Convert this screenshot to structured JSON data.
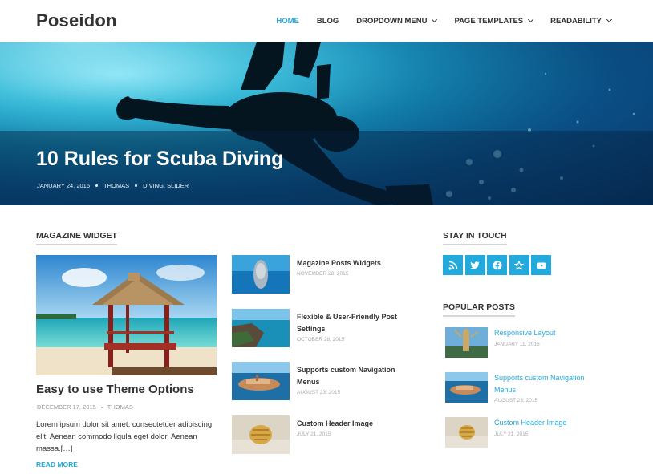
{
  "site": {
    "title": "Poseidon"
  },
  "nav": {
    "items": [
      {
        "label": "HOME"
      },
      {
        "label": "BLOG"
      },
      {
        "label": "DROPDOWN MENU"
      },
      {
        "label": "PAGE TEMPLATES"
      },
      {
        "label": "READABILITY"
      }
    ]
  },
  "hero": {
    "title": "10 Rules for Scuba Diving",
    "date": "JANUARY 24, 2016",
    "author": "THOMAS",
    "categories": "DIVING, SLIDER"
  },
  "magazine": {
    "heading": "MAGAZINE WIDGET",
    "featured": {
      "title": "Easy to use Theme Options",
      "date": "DECEMBER 17, 2015",
      "author": "THOMAS",
      "excerpt": "Lorem ipsum dolor sit amet, consectetuer adipiscing elit. Aenean commodo ligula eget dolor. Aenean massa.[…]",
      "read_more": "READ MORE"
    },
    "posts": [
      {
        "title": "Magazine Posts Widgets",
        "date": "NOVEMBER 28, 2015",
        "thumb": "dolphin"
      },
      {
        "title": "Flexible & User-Friendly Post Settings",
        "date": "OCTOBER 28, 2015",
        "thumb": "coast"
      },
      {
        "title": "Supports custom Navigation Menus",
        "date": "AUGUST 23, 2015",
        "thumb": "town"
      },
      {
        "title": "Custom Header Image",
        "date": "JULY 21, 2015",
        "thumb": "shell"
      }
    ]
  },
  "sidebar": {
    "stay_heading": "STAY IN TOUCH",
    "social": [
      {
        "icon": "rss-icon"
      },
      {
        "icon": "twitter-icon"
      },
      {
        "icon": "facebook-icon"
      },
      {
        "icon": "star-icon"
      },
      {
        "icon": "youtube-icon"
      }
    ],
    "popular_heading": "POPULAR POSTS",
    "popular": [
      {
        "title": "Responsive Layout",
        "date": "JANUARY 11, 2016",
        "thumb": "statue"
      },
      {
        "title": "Supports custom Navigation Menus",
        "date": "AUGUST 23, 2015",
        "thumb": "town"
      },
      {
        "title": "Custom Header Image",
        "date": "JULY 21, 2015",
        "thumb": "shell"
      }
    ]
  },
  "colors": {
    "accent": "#22aadd",
    "text": "#333333",
    "muted": "#999999"
  }
}
